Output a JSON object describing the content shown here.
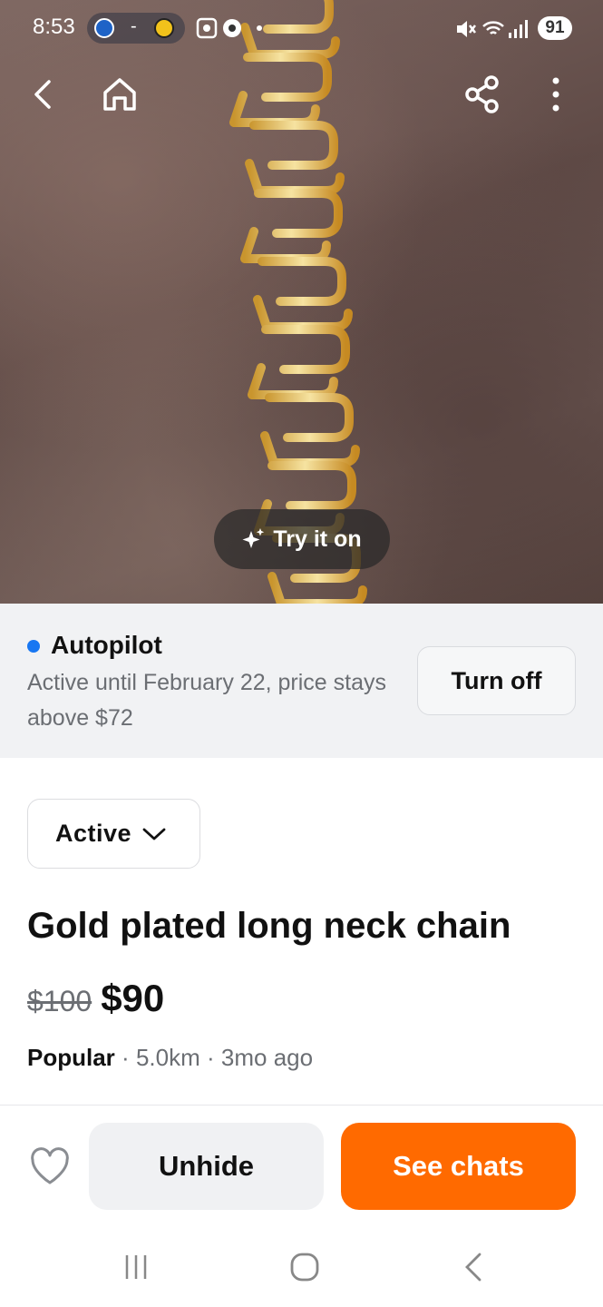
{
  "status_bar": {
    "time": "8:53",
    "battery": "91",
    "team_dot_colors": [
      "#1e63c7",
      "#f2c21b"
    ]
  },
  "nav": {
    "icons": [
      "back-icon",
      "home-icon",
      "share-icon",
      "more-vert-icon"
    ]
  },
  "hero": {
    "try_on_label": "Try it on",
    "try_on_icon": "sparkle-icon"
  },
  "autopilot": {
    "title": "Autopilot",
    "description": "Active until February 22, price stays above $72",
    "turn_off_label": "Turn off",
    "dot_color": "#1877f2"
  },
  "listing": {
    "status": "Active",
    "title": "Gold plated long neck chain",
    "old_price": "$100",
    "price": "$90",
    "popularity": "Popular",
    "distance": "5.0km",
    "age": "3mo ago",
    "separator": "·"
  },
  "actions": {
    "unhide_label": "Unhide",
    "see_chats_label": "See chats",
    "accent_color": "#ff6a00"
  },
  "system_nav": {
    "icons": [
      "recent-apps-icon",
      "home-circle-icon",
      "system-back-icon"
    ]
  }
}
